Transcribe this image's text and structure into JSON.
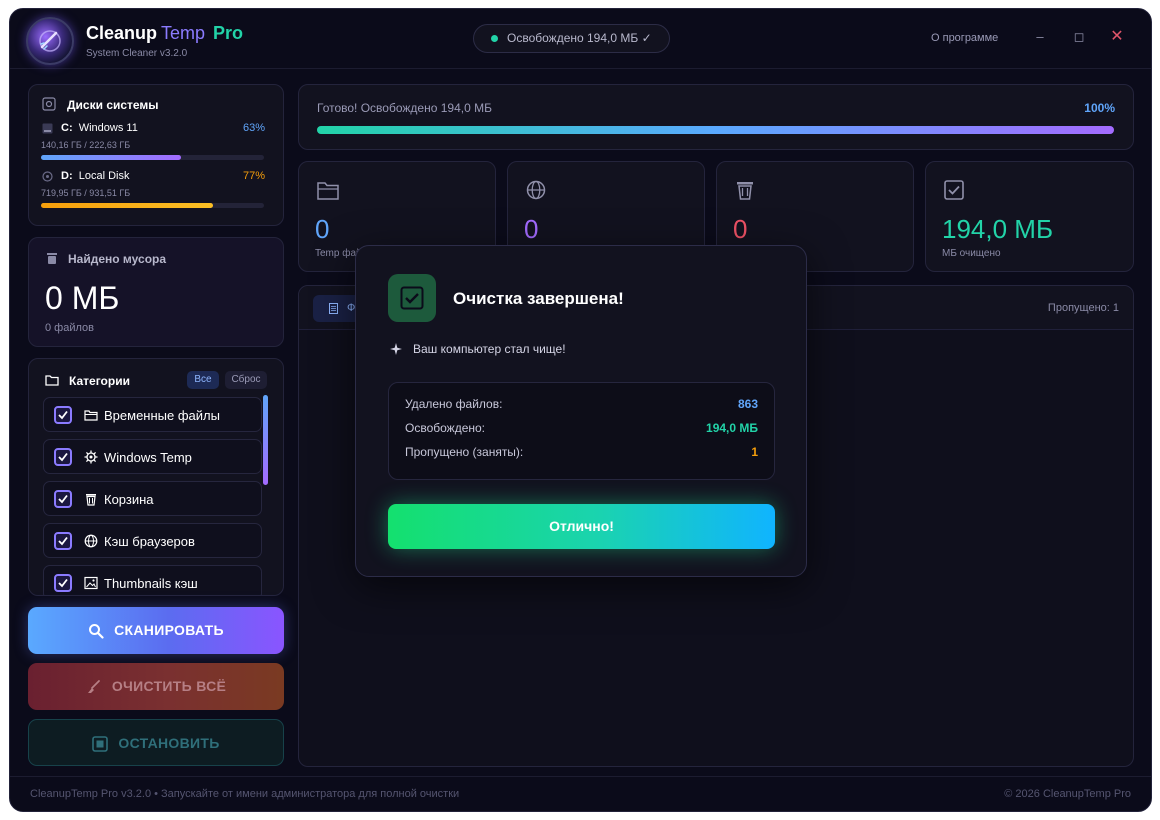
{
  "app": {
    "title_part1": "Cleanup",
    "title_part2": "Temp",
    "title_part3": "Pro",
    "subtitle": "System Cleaner v3.2.0",
    "status_pill": "Освобождено 194,0 МБ ✓",
    "about_link": "О программе",
    "minimize": "–",
    "maximize": "◻",
    "close": "✕"
  },
  "disks": {
    "title": "Диски системы",
    "items": [
      {
        "letter": "C:",
        "name": "Windows 11",
        "percent_label": "63%",
        "usage_fraction": 0.63,
        "size": "140,16 ГБ / 222,63 ГБ",
        "color": "#8b7bff"
      },
      {
        "letter": "D:",
        "name": "Local Disk",
        "percent_label": "77%",
        "usage_fraction": 0.77,
        "size": "719,95 ГБ / 931,51 ГБ",
        "color": "#f59e0b"
      }
    ]
  },
  "junk": {
    "title": "Найдено мусора",
    "value": "0 МБ",
    "files": "0 файлов"
  },
  "categories": {
    "title": "Категории",
    "all_label": "Все",
    "reset_label": "Сброс",
    "items": [
      {
        "label": "Временные файлы",
        "icon": "folder-icon",
        "checked": true
      },
      {
        "label": "Windows Temp",
        "icon": "gear-icon",
        "checked": true
      },
      {
        "label": "Корзина",
        "icon": "trash-icon",
        "checked": true
      },
      {
        "label": "Кэш браузеров",
        "icon": "globe-icon",
        "checked": true
      },
      {
        "label": "Thumbnails кэш",
        "icon": "image-icon",
        "checked": true
      }
    ]
  },
  "actions": {
    "scan": "СКАНИРОВАТЬ",
    "clean_all": "ОЧИСТИТЬ ВСЁ",
    "stop": "ОСТАНОВИТЬ"
  },
  "progress": {
    "label": "Готово! Освобождено 194,0 МБ",
    "percent_label": "100%",
    "fraction": 1.0
  },
  "stats": [
    {
      "value": "0",
      "label": "Temp фай",
      "icon": "folder-icon",
      "color": "#60a5fa"
    },
    {
      "value": "0",
      "label": "",
      "icon": "globe-icon",
      "color": "#a36bff"
    },
    {
      "value": "0",
      "label": "",
      "icon": "trash-icon",
      "color": "#f05266"
    },
    {
      "value": "194,0 МБ",
      "label": "МБ очищено",
      "icon": "check-square-icon",
      "color": "#22d3a8"
    }
  ],
  "log": {
    "tab_label": "Ф",
    "skipped": "Пропущено: 1"
  },
  "modal": {
    "title": "Очистка завершена!",
    "subtitle": "Ваш компьютер стал чище!",
    "rows": [
      {
        "label": "Удалено файлов:",
        "value": "863",
        "color": "#60a5fa"
      },
      {
        "label": "Освобождено:",
        "value": "194,0 МБ",
        "color": "#22d3a8"
      },
      {
        "label": "Пропущено (заняты):",
        "value": "1",
        "color": "#f59e0b"
      }
    ],
    "button": "Отлично!"
  },
  "footer": {
    "left": "CleanupTemp Pro v3.2.0  •  Запускайте от имени администратора для полной очистки",
    "right": "© 2026 CleanupTemp Pro"
  }
}
